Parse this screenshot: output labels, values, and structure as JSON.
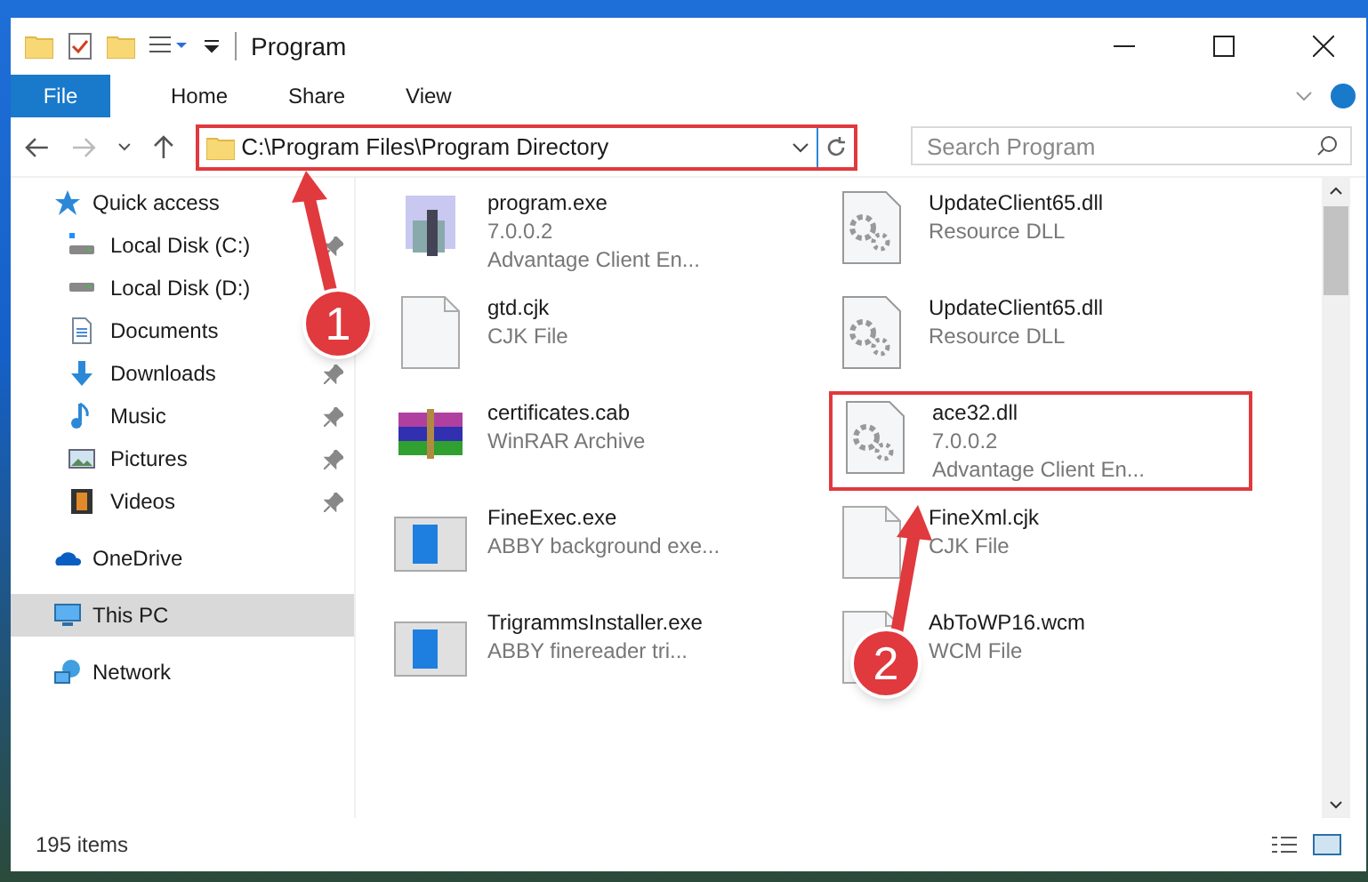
{
  "window": {
    "title": "Program"
  },
  "ribbon_tabs": [
    {
      "label": "File",
      "kind": "menu"
    },
    {
      "label": "Home",
      "kind": "tab"
    },
    {
      "label": "Share",
      "kind": "tab"
    },
    {
      "label": "View",
      "kind": "tab"
    }
  ],
  "address": {
    "path": "C:\\Program Files\\Program Directory",
    "highlighted": true
  },
  "search": {
    "placeholder": "Search Program"
  },
  "sidebar": {
    "items": [
      {
        "label": "Quick access",
        "kind": "star",
        "selected": false,
        "children": [
          {
            "label": "Local Disk (C:)",
            "kind": "drive-c",
            "pinned": true
          },
          {
            "label": "Local Disk (D:)",
            "kind": "drive"
          },
          {
            "label": "Documents",
            "kind": "documents"
          },
          {
            "label": "Downloads",
            "kind": "downloads",
            "pinned": true
          },
          {
            "label": "Music",
            "kind": "music",
            "pinned": true
          },
          {
            "label": "Pictures",
            "kind": "pictures",
            "pinned": true
          },
          {
            "label": "Videos",
            "kind": "videos",
            "pinned": true
          }
        ]
      },
      {
        "label": "OneDrive",
        "kind": "cloud",
        "selected": false
      },
      {
        "label": "This PC",
        "kind": "pc",
        "selected": true
      },
      {
        "label": "Network",
        "kind": "network",
        "selected": false
      }
    ]
  },
  "files": [
    {
      "name": "program.exe",
      "details": [
        "7.0.0.2",
        "Advantage Client En..."
      ],
      "kind": "setup",
      "highlighted": false
    },
    {
      "name": "UpdateClient65.dll",
      "details": [
        "Resource DLL"
      ],
      "kind": "dll",
      "highlighted": false
    },
    {
      "name": "gtd.cjk",
      "details": [
        "CJK File"
      ],
      "kind": "blank",
      "highlighted": false
    },
    {
      "name": "UpdateClient65.dll",
      "details": [
        "Resource DLL"
      ],
      "kind": "dll",
      "highlighted": false
    },
    {
      "name": "certificates.cab",
      "details": [
        "WinRAR Archive"
      ],
      "kind": "archive",
      "highlighted": false
    },
    {
      "name": "ace32.dll",
      "details": [
        "7.0.0.2",
        "Advantage Client En..."
      ],
      "kind": "dll",
      "highlighted": true
    },
    {
      "name": "FineExec.exe",
      "details": [
        "ABBY background exe..."
      ],
      "kind": "app",
      "highlighted": false
    },
    {
      "name": "FineXml.cjk",
      "details": [
        "CJK File"
      ],
      "kind": "blank",
      "highlighted": false
    },
    {
      "name": "TrigrammsInstaller.exe",
      "details": [
        "ABBY finereader tri..."
      ],
      "kind": "app",
      "highlighted": false
    },
    {
      "name": "AbToWP16.wcm",
      "details": [
        "WCM File"
      ],
      "kind": "blank",
      "highlighted": false
    }
  ],
  "status_bar": {
    "count": "195 items"
  },
  "callouts": [
    {
      "number": "1"
    },
    {
      "number": "2"
    }
  ]
}
